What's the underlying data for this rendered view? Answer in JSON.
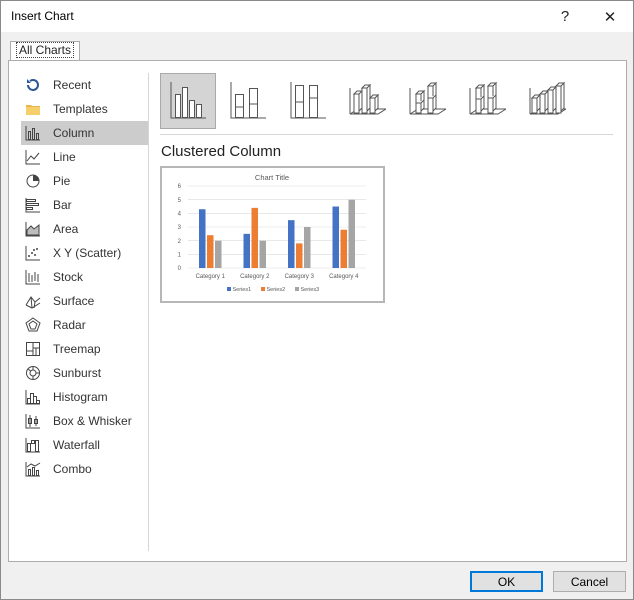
{
  "window": {
    "title": "Insert Chart",
    "help_glyph": "?",
    "close_glyph": "✕"
  },
  "tabs": [
    {
      "label": "All Charts"
    }
  ],
  "sidebar": {
    "items": [
      {
        "label": "Recent",
        "icon": "recent-icon"
      },
      {
        "label": "Templates",
        "icon": "templates-folder-icon"
      },
      {
        "label": "Column",
        "icon": "column-chart-icon",
        "selected": true
      },
      {
        "label": "Line",
        "icon": "line-chart-icon"
      },
      {
        "label": "Pie",
        "icon": "pie-chart-icon"
      },
      {
        "label": "Bar",
        "icon": "bar-chart-icon"
      },
      {
        "label": "Area",
        "icon": "area-chart-icon"
      },
      {
        "label": "X Y (Scatter)",
        "icon": "scatter-chart-icon"
      },
      {
        "label": "Stock",
        "icon": "stock-chart-icon"
      },
      {
        "label": "Surface",
        "icon": "surface-chart-icon"
      },
      {
        "label": "Radar",
        "icon": "radar-chart-icon"
      },
      {
        "label": "Treemap",
        "icon": "treemap-chart-icon"
      },
      {
        "label": "Sunburst",
        "icon": "sunburst-chart-icon"
      },
      {
        "label": "Histogram",
        "icon": "histogram-chart-icon"
      },
      {
        "label": "Box & Whisker",
        "icon": "box-whisker-chart-icon"
      },
      {
        "label": "Waterfall",
        "icon": "waterfall-chart-icon"
      },
      {
        "label": "Combo",
        "icon": "combo-chart-icon"
      }
    ]
  },
  "main": {
    "variants": [
      {
        "icon": "clustered-column-icon",
        "selected": true
      },
      {
        "icon": "stacked-column-icon"
      },
      {
        "icon": "100-stacked-column-icon"
      },
      {
        "icon": "3d-clustered-column-icon"
      },
      {
        "icon": "3d-stacked-column-icon"
      },
      {
        "icon": "3d-100-stacked-column-icon"
      },
      {
        "icon": "3d-column-icon"
      }
    ],
    "selected_type_title": "Clustered Column"
  },
  "chart_data": {
    "type": "bar",
    "title": "Chart Title",
    "categories": [
      "Category 1",
      "Category 2",
      "Category 3",
      "Category 4"
    ],
    "series": [
      {
        "name": "Series1",
        "values": [
          4.3,
          2.5,
          3.5,
          4.5
        ],
        "color": "#4472c4"
      },
      {
        "name": "Series2",
        "values": [
          2.4,
          4.4,
          1.8,
          2.8
        ],
        "color": "#ed7d31"
      },
      {
        "name": "Series3",
        "values": [
          2,
          2,
          3,
          5
        ],
        "color": "#a5a5a5"
      }
    ],
    "ylim": [
      0,
      6
    ],
    "yticks": [
      0,
      1,
      2,
      3,
      4,
      5,
      6
    ],
    "grid": true,
    "legend_position": "bottom"
  },
  "buttons": {
    "ok": "OK",
    "cancel": "Cancel"
  },
  "colors": {
    "selection_gray": "#cccccc",
    "ok_border": "#0078d7"
  }
}
